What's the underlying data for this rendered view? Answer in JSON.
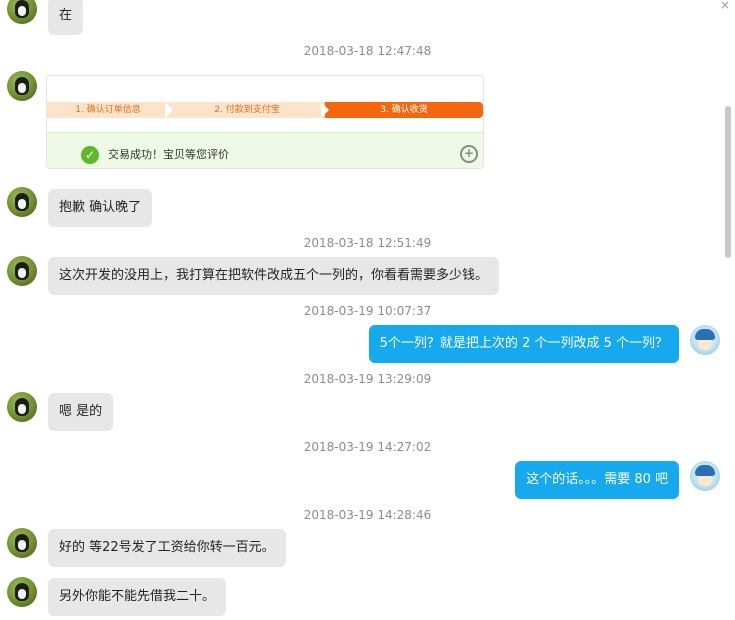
{
  "messages": [
    {
      "text": "在"
    },
    {
      "text": "抱歉 确认晚了"
    },
    {
      "text": "这次开发的没用上，我打算在把软件改成五个一列的，你看看需要多少钱。"
    },
    {
      "text": "5个一列？就是把上次的 2 个一列改成 5 个一列？"
    },
    {
      "text": "嗯 是的"
    },
    {
      "text": "这个的话。。。需要 80 吧"
    },
    {
      "text": "好的 等22号发了工资给你转一百元。"
    },
    {
      "text": "另外你能不能先借我二十。"
    }
  ],
  "timestamps": [
    "2018-03-18 12:47:48",
    "2018-03-18 12:51:49",
    "2018-03-19 10:07:37",
    "2018-03-19 13:29:09",
    "2018-03-19 14:27:02",
    "2018-03-19 14:28:46"
  ],
  "order_card": {
    "steps": [
      "1. 确认订单信息",
      "2. 付款到支付宝",
      "3. 确认收货"
    ],
    "success_text": "交易成功！宝贝等您评价",
    "active_step": 3
  },
  "icons": {
    "close": "close-icon",
    "check": "check-circle-icon",
    "zoom": "zoom-in-icon"
  },
  "colors": {
    "my_bubble": "#17a9ee",
    "their_bubble": "#e7e7e7",
    "active_step": "#f5670e"
  }
}
